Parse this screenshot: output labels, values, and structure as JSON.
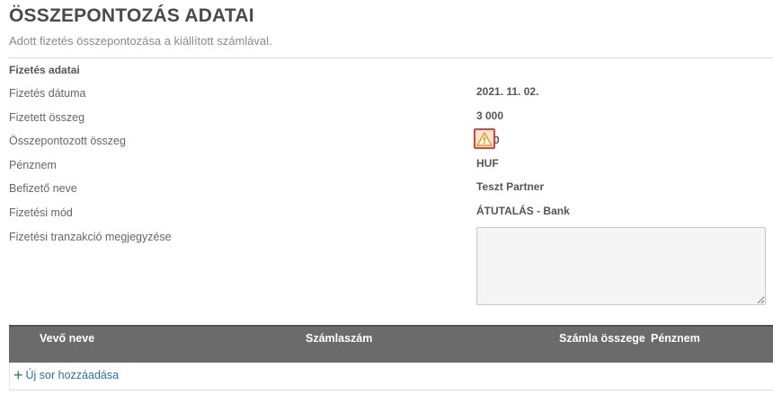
{
  "header": {
    "title": "ÖSSZEPONTOZÁS ADATAI",
    "subtitle": "Adott fizetés összepontozása a kiállított számlával."
  },
  "payment": {
    "section_label": "Fizetés adatai",
    "rows": [
      {
        "label": "Fizetés dátuma",
        "value": "2021. 11. 02."
      },
      {
        "label": "Fizetett összeg",
        "value": "3 000"
      },
      {
        "label": "Összepontozott összeg",
        "value": "0"
      },
      {
        "label": "Pénznem",
        "value": "HUF"
      },
      {
        "label": "Befizető neve",
        "value": "Teszt Partner"
      },
      {
        "label": "Fizetési mód",
        "value": "ÁTUTALÁS - Bank"
      },
      {
        "label": "Fizetési tranzakció megjegyzése",
        "value": ""
      }
    ],
    "warning_icon": "warning-triangle-icon"
  },
  "table": {
    "columns": [
      "Vevő neve",
      "Számlaszám",
      "Számla összege",
      "Pénznem"
    ],
    "add_row_label": "Új sor hozzáadása"
  },
  "colors": {
    "header_bg": "#6b6b6b",
    "warning_border": "#d9473a",
    "link": "#2c6fb0",
    "plus": "#1a8f4b"
  }
}
